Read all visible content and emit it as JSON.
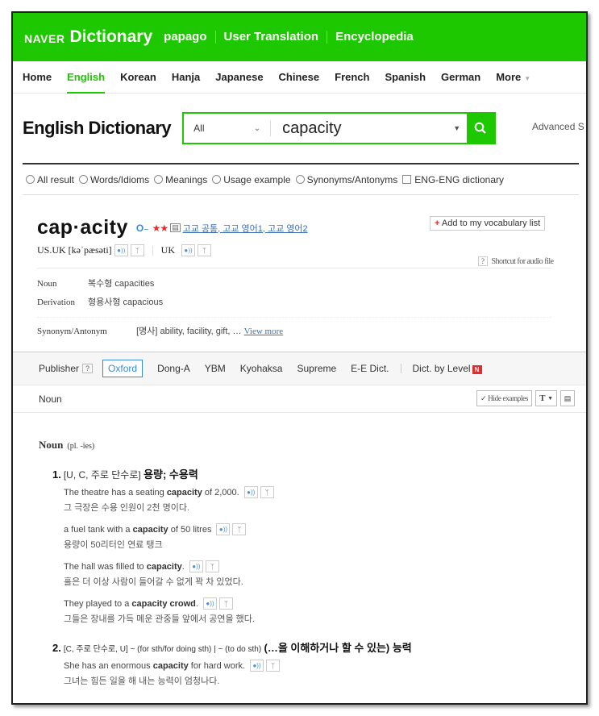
{
  "brand": {
    "naver": "NAVER",
    "dict": "Dictionary"
  },
  "topnav": [
    "papago",
    "User Translation",
    "Encyclopedia"
  ],
  "langnav": {
    "items": [
      "Home",
      "English",
      "Korean",
      "Hanja",
      "Japanese",
      "Chinese",
      "French",
      "Spanish",
      "German",
      "More"
    ],
    "active": "English"
  },
  "search": {
    "title": "English Dictionary",
    "scope": "All",
    "query": "capacity",
    "advanced": "Advanced S"
  },
  "filters": [
    "All result",
    "Words/Idioms",
    "Meanings",
    "Usage example",
    "Synonyms/Antonyms"
  ],
  "filter_checkbox": "ENG-ENG dictionary",
  "entry": {
    "word": "cap·acity",
    "stars": "★★",
    "levels": "고교 공통, 고교 영어1, 고교 영어2",
    "vocab_button": "Add to my vocabulary list",
    "us_uk_label": "US.UK",
    "ipa": "[kəˈpæsəti]",
    "uk_label": "UK",
    "shortcut_label": "Shortcut for audio file",
    "noun_label": "Noun",
    "noun_value": "복수형 capacities",
    "derivation_label": "Derivation",
    "derivation_value": "형용사형 capacious",
    "synonym_label": "Synonym/Antonym",
    "synonym_value": "[명사] ability, facility, gift, …",
    "view_more": "View more"
  },
  "publisher": {
    "label": "Publisher",
    "tabs": [
      "Oxford",
      "Dong-A",
      "YBM",
      "Kyohaksa",
      "Supreme",
      "E-E Dict."
    ],
    "active": "Oxford",
    "level": "Dict. by Level"
  },
  "posbar": {
    "label": "Noun",
    "hide": "Hide examples",
    "t": "T"
  },
  "definition": {
    "pos": "Noun",
    "plural": "(pl. -ies)",
    "senses": [
      {
        "num": "1.",
        "gram": "[U, C, 주로 단수로]",
        "def": "용량; 수용력",
        "examples": [
          {
            "pre": "The theatre has a seating ",
            "bold": "capacity",
            "post": " of 2,000.",
            "ko": "그 극장은 수용 인원이 2천 명이다."
          },
          {
            "pre": "a fuel tank with a ",
            "bold": "capacity",
            "post": " of 50 litres",
            "ko": "용량이 50리터인 연료 탱크"
          },
          {
            "pre": "The hall was filled to ",
            "bold": "capacity",
            "post": ".",
            "ko": "홀은 더 이상 사람이 들어갈 수 없게 꽉 차 있었다."
          },
          {
            "pre": "They played to a ",
            "bold": "capacity crowd",
            "post": ".",
            "ko": "그들은 장내를 가득 메운 관중들 앞에서 공연을 했다."
          }
        ]
      },
      {
        "num": "2.",
        "gram": "[C, 주로 단수로, U] ~ (for sth/for doing sth) | ~ (to do sth)",
        "def": "(…을 이해하거나 할 수 있는) 능력",
        "examples": [
          {
            "pre": "She has an enormous ",
            "bold": "capacity",
            "post": " for hard work.",
            "ko": "그녀는 힘든 일을 해 내는 능력이 엄청나다."
          }
        ]
      }
    ]
  },
  "colors": {
    "brand_green": "#1ec800",
    "link_blue": "#3a6fb5",
    "star_red": "#e02d2d"
  }
}
